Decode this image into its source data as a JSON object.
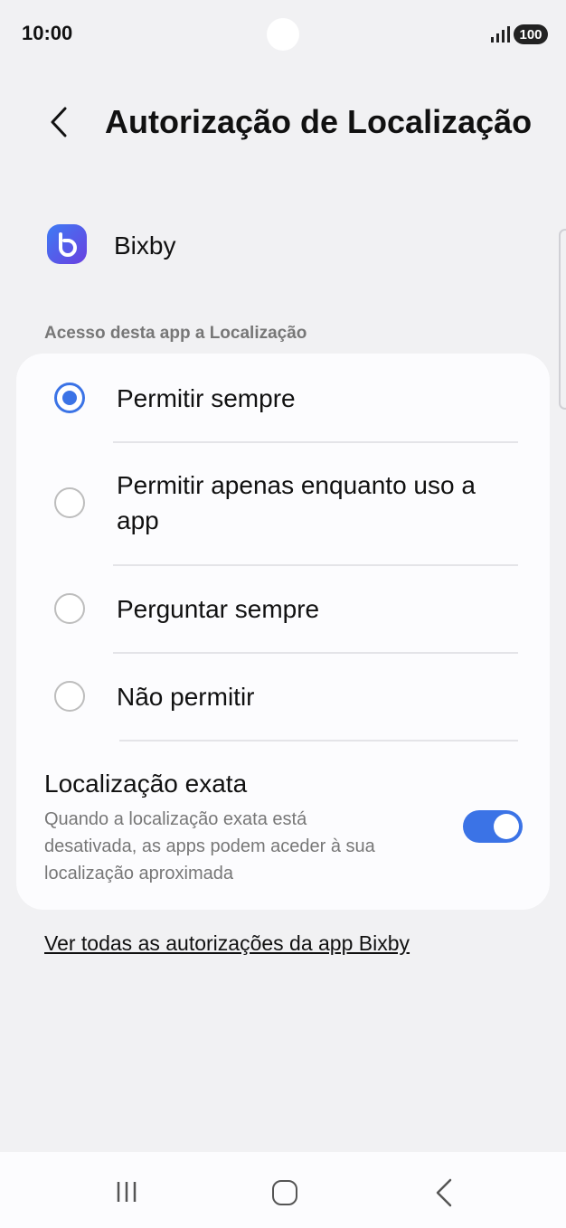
{
  "status_bar": {
    "time": "10:00",
    "battery": "100",
    "signal_icon": "signal-icon"
  },
  "header": {
    "title": "Autorização de Localização",
    "back_icon": "chevron-left-icon"
  },
  "app": {
    "name": "Bixby",
    "icon": "bixby-app-icon"
  },
  "section_label": "Acesso desta app a Localização",
  "options": [
    {
      "label": "Permitir sempre",
      "selected": true
    },
    {
      "label": "Permitir apenas enquanto uso a app",
      "selected": false
    },
    {
      "label": "Perguntar sempre",
      "selected": false
    },
    {
      "label": "Não permitir",
      "selected": false
    }
  ],
  "exact_location": {
    "title": "Localização exata",
    "description": "Quando a localização exata está desativada, as apps podem aceder à sua localização aproximada",
    "enabled": true
  },
  "link": "Ver todas as autorizações da app Bixby",
  "nav": {
    "recents_icon": "recents-icon",
    "home_icon": "home-icon",
    "back_icon": "back-icon"
  },
  "colors": {
    "accent": "#3b73e6",
    "background": "#f1f1f3",
    "card": "#fcfcfe"
  }
}
